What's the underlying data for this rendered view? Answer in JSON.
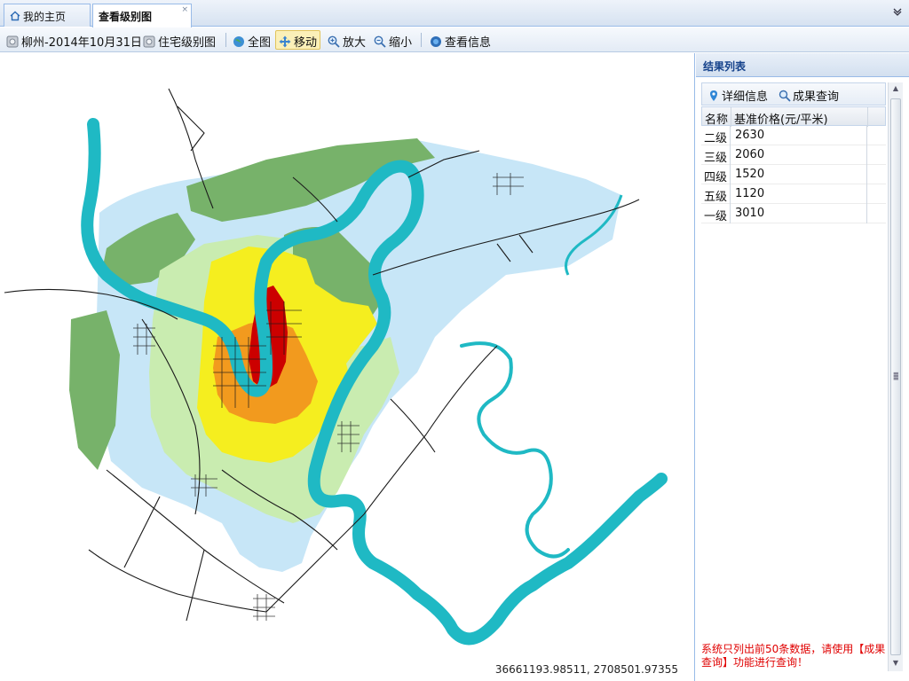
{
  "tabs": [
    {
      "label": "我的主页",
      "active": false,
      "icon": "home-icon"
    },
    {
      "label": "查看级别图",
      "active": true,
      "close": "×"
    }
  ],
  "toolbar": {
    "dataset_label": "柳州-2014年10月31日",
    "layer_label": "住宅级别图",
    "full_extent_label": "全图",
    "pan_label": "移动",
    "zoom_in_label": "放大",
    "zoom_out_label": "缩小",
    "info_label": "查看信息",
    "active_tool": "移动"
  },
  "map": {
    "coordinates": "36661193.98511, 2708501.97355",
    "colors": {
      "river": "#1fb9c4",
      "level1": "#cc0000",
      "level2": "#f29a1e",
      "level3": "#f5ee1f",
      "level4": "#c9ecb0",
      "level5": "#c7e6f7",
      "green": "#77b26a",
      "road": "#1a1a1a"
    }
  },
  "panel": {
    "title": "结果列表",
    "details_label": "详细信息",
    "query_label": "成果查询",
    "columns": [
      "名称",
      "基准价格(元/平米)"
    ],
    "rows": [
      {
        "name": "二级",
        "price": "2630"
      },
      {
        "name": "三级",
        "price": "2060"
      },
      {
        "name": "四级",
        "price": "1520"
      },
      {
        "name": "五级",
        "price": "1120"
      },
      {
        "name": "一级",
        "price": "3010"
      }
    ],
    "notice": "系统只列出前50条数据，请使用【成果查询】功能进行查询！"
  }
}
